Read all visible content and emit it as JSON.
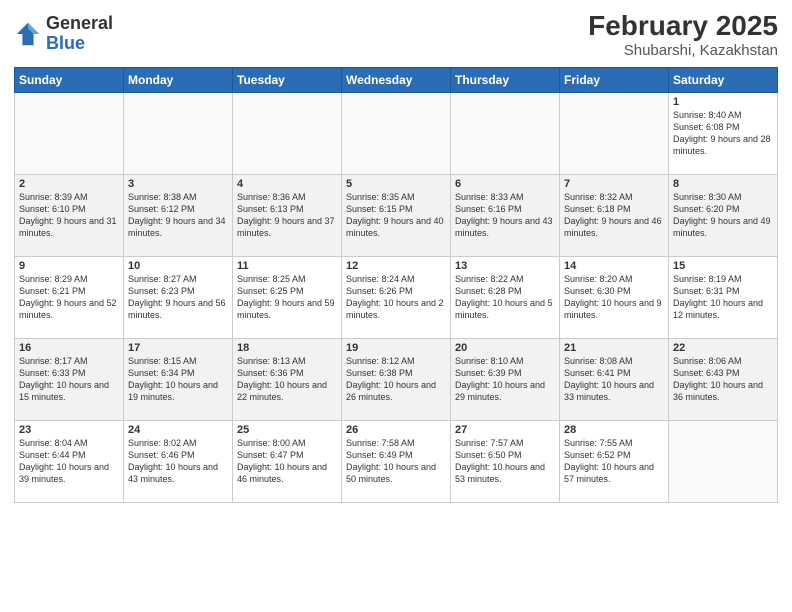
{
  "header": {
    "logo": {
      "general": "General",
      "blue": "Blue"
    },
    "title": "February 2025",
    "subtitle": "Shubarshi, Kazakhstan"
  },
  "weekdays": [
    "Sunday",
    "Monday",
    "Tuesday",
    "Wednesday",
    "Thursday",
    "Friday",
    "Saturday"
  ],
  "weeks": [
    [
      {
        "day": "",
        "info": ""
      },
      {
        "day": "",
        "info": ""
      },
      {
        "day": "",
        "info": ""
      },
      {
        "day": "",
        "info": ""
      },
      {
        "day": "",
        "info": ""
      },
      {
        "day": "",
        "info": ""
      },
      {
        "day": "1",
        "info": "Sunrise: 8:40 AM\nSunset: 6:08 PM\nDaylight: 9 hours and 28 minutes."
      }
    ],
    [
      {
        "day": "2",
        "info": "Sunrise: 8:39 AM\nSunset: 6:10 PM\nDaylight: 9 hours and 31 minutes."
      },
      {
        "day": "3",
        "info": "Sunrise: 8:38 AM\nSunset: 6:12 PM\nDaylight: 9 hours and 34 minutes."
      },
      {
        "day": "4",
        "info": "Sunrise: 8:36 AM\nSunset: 6:13 PM\nDaylight: 9 hours and 37 minutes."
      },
      {
        "day": "5",
        "info": "Sunrise: 8:35 AM\nSunset: 6:15 PM\nDaylight: 9 hours and 40 minutes."
      },
      {
        "day": "6",
        "info": "Sunrise: 8:33 AM\nSunset: 6:16 PM\nDaylight: 9 hours and 43 minutes."
      },
      {
        "day": "7",
        "info": "Sunrise: 8:32 AM\nSunset: 6:18 PM\nDaylight: 9 hours and 46 minutes."
      },
      {
        "day": "8",
        "info": "Sunrise: 8:30 AM\nSunset: 6:20 PM\nDaylight: 9 hours and 49 minutes."
      }
    ],
    [
      {
        "day": "9",
        "info": "Sunrise: 8:29 AM\nSunset: 6:21 PM\nDaylight: 9 hours and 52 minutes."
      },
      {
        "day": "10",
        "info": "Sunrise: 8:27 AM\nSunset: 6:23 PM\nDaylight: 9 hours and 56 minutes."
      },
      {
        "day": "11",
        "info": "Sunrise: 8:25 AM\nSunset: 6:25 PM\nDaylight: 9 hours and 59 minutes."
      },
      {
        "day": "12",
        "info": "Sunrise: 8:24 AM\nSunset: 6:26 PM\nDaylight: 10 hours and 2 minutes."
      },
      {
        "day": "13",
        "info": "Sunrise: 8:22 AM\nSunset: 6:28 PM\nDaylight: 10 hours and 5 minutes."
      },
      {
        "day": "14",
        "info": "Sunrise: 8:20 AM\nSunset: 6:30 PM\nDaylight: 10 hours and 9 minutes."
      },
      {
        "day": "15",
        "info": "Sunrise: 8:19 AM\nSunset: 6:31 PM\nDaylight: 10 hours and 12 minutes."
      }
    ],
    [
      {
        "day": "16",
        "info": "Sunrise: 8:17 AM\nSunset: 6:33 PM\nDaylight: 10 hours and 15 minutes."
      },
      {
        "day": "17",
        "info": "Sunrise: 8:15 AM\nSunset: 6:34 PM\nDaylight: 10 hours and 19 minutes."
      },
      {
        "day": "18",
        "info": "Sunrise: 8:13 AM\nSunset: 6:36 PM\nDaylight: 10 hours and 22 minutes."
      },
      {
        "day": "19",
        "info": "Sunrise: 8:12 AM\nSunset: 6:38 PM\nDaylight: 10 hours and 26 minutes."
      },
      {
        "day": "20",
        "info": "Sunrise: 8:10 AM\nSunset: 6:39 PM\nDaylight: 10 hours and 29 minutes."
      },
      {
        "day": "21",
        "info": "Sunrise: 8:08 AM\nSunset: 6:41 PM\nDaylight: 10 hours and 33 minutes."
      },
      {
        "day": "22",
        "info": "Sunrise: 8:06 AM\nSunset: 6:43 PM\nDaylight: 10 hours and 36 minutes."
      }
    ],
    [
      {
        "day": "23",
        "info": "Sunrise: 8:04 AM\nSunset: 6:44 PM\nDaylight: 10 hours and 39 minutes."
      },
      {
        "day": "24",
        "info": "Sunrise: 8:02 AM\nSunset: 6:46 PM\nDaylight: 10 hours and 43 minutes."
      },
      {
        "day": "25",
        "info": "Sunrise: 8:00 AM\nSunset: 6:47 PM\nDaylight: 10 hours and 46 minutes."
      },
      {
        "day": "26",
        "info": "Sunrise: 7:58 AM\nSunset: 6:49 PM\nDaylight: 10 hours and 50 minutes."
      },
      {
        "day": "27",
        "info": "Sunrise: 7:57 AM\nSunset: 6:50 PM\nDaylight: 10 hours and 53 minutes."
      },
      {
        "day": "28",
        "info": "Sunrise: 7:55 AM\nSunset: 6:52 PM\nDaylight: 10 hours and 57 minutes."
      },
      {
        "day": "",
        "info": ""
      }
    ]
  ]
}
